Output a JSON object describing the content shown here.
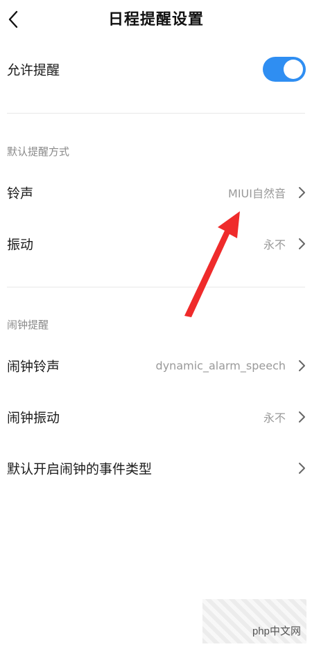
{
  "header": {
    "title": "日程提醒设置",
    "back_icon": "chevron-left-icon"
  },
  "allow": {
    "label": "允许提醒",
    "enabled": true,
    "accent": "#2f8ef2"
  },
  "section_default": {
    "title": "默认提醒方式"
  },
  "ringtone": {
    "label": "铃声",
    "value": "MIUI自然音"
  },
  "vibration": {
    "label": "振动",
    "value": "永不"
  },
  "section_alarm": {
    "title": "闹钟提醒"
  },
  "alarm_ringtone": {
    "label": "闹钟铃声",
    "value": "dynamic_alarm_speech"
  },
  "alarm_vibration": {
    "label": "闹钟振动",
    "value": "永不"
  },
  "alarm_event_types": {
    "label": "默认开启闹钟的事件类型"
  },
  "annotation": {
    "arrow_color": "#ef2b2b"
  },
  "watermark": {
    "text": "php中文网"
  }
}
